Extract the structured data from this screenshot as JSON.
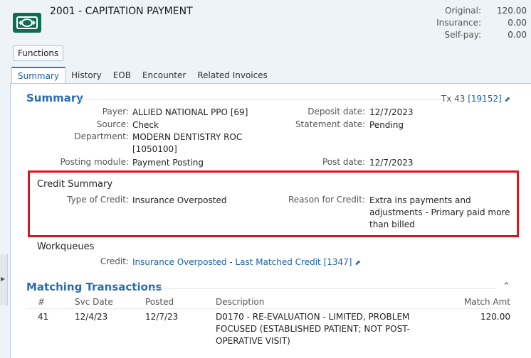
{
  "header": {
    "title": "2001 - CAPITATION PAYMENT",
    "amounts": [
      {
        "label": "Original:",
        "value": "120.00"
      },
      {
        "label": "Insurance:",
        "value": "0.00"
      },
      {
        "label": "Self-pay:",
        "value": "0.00"
      }
    ]
  },
  "toolbar": {
    "functions_label": "Functions"
  },
  "tabs": [
    "Summary",
    "History",
    "EOB",
    "Encounter",
    "Related Invoices"
  ],
  "summary": {
    "title": "Summary",
    "tx_prefix": "Tx 43",
    "tx_link": "[19152]",
    "payer_label": "Payer:",
    "payer": "ALLIED NATIONAL PPO [69]",
    "source_label": "Source:",
    "source": "Check",
    "department_label": "Department:",
    "department_line1": "MODERN DENTISTRY ROC",
    "department_line2": "[1050100]",
    "posting_module_label": "Posting module:",
    "posting_module": "Payment Posting",
    "deposit_date_label": "Deposit date:",
    "deposit_date": "12/7/2023",
    "statement_date_label": "Statement date:",
    "statement_date": "Pending",
    "post_date_label": "Post date:",
    "post_date": "12/7/2023"
  },
  "credit_summary": {
    "title": "Credit Summary",
    "type_label": "Type of Credit:",
    "type": "Insurance Overposted",
    "reason_label": "Reason for Credit:",
    "reason_line1": "Extra ins payments and",
    "reason_line2": "adjustments - Primary paid more",
    "reason_line3": "than billed"
  },
  "workqueues": {
    "title": "Workqueues",
    "credit_label": "Credit:",
    "credit_link": "Insurance Overposted - Last Matched Credit [1347]"
  },
  "matching": {
    "title": "Matching Transactions",
    "columns": [
      "#",
      "Svc Date",
      "Posted",
      "Description",
      "Match Amt"
    ],
    "rows": [
      {
        "num": "41",
        "svc_date": "12/4/23",
        "posted": "12/7/23",
        "desc_line1": "D0170 - RE-EVALUATION - LIMITED, PROBLEM",
        "desc_line2": "FOCUSED (ESTABLISHED PATIENT; NOT POST-",
        "desc_line3": "OPERATIVE VISIT)",
        "amt": "120.00"
      }
    ]
  },
  "icons": {
    "logo": "payment-logo-icon",
    "external": "external-link-icon",
    "collapse": "double-chevron-up-icon",
    "side": "triangle-right-icon"
  },
  "colors": {
    "accent": "#2a6db3",
    "highlight_box": "#d9161c",
    "logo_bg": "#0e6d4f"
  }
}
